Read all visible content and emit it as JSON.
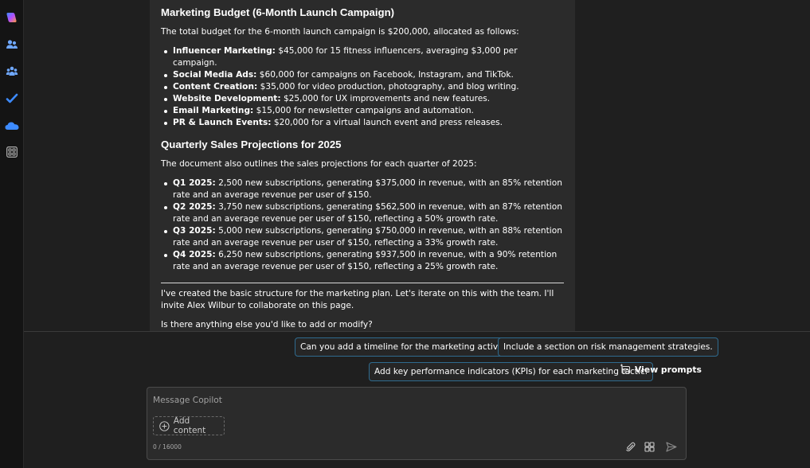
{
  "message": {
    "budget_heading": "Marketing Budget (6-Month Launch Campaign)",
    "budget_intro": "The total budget for the 6-month launch campaign is $200,000, allocated as follows:",
    "budget_items": [
      {
        "label": "Influencer Marketing:",
        "text": " $45,000 for 15 fitness influencers, averaging $3,000 per campaign."
      },
      {
        "label": "Social Media Ads:",
        "text": " $60,000 for campaigns on Facebook, Instagram, and TikTok."
      },
      {
        "label": "Content Creation:",
        "text": " $35,000 for video production, photography, and blog writing."
      },
      {
        "label": "Website Development:",
        "text": " $25,000 for UX improvements and new features."
      },
      {
        "label": "Email Marketing:",
        "text": " $15,000 for newsletter campaigns and automation."
      },
      {
        "label": "PR & Launch Events:",
        "text": " $20,000 for a virtual launch event and press releases."
      }
    ],
    "sales_heading": "Quarterly Sales Projections for 2025",
    "sales_intro": "The document also outlines the sales projections for each quarter of 2025:",
    "sales_items": [
      {
        "label": "Q1 2025:",
        "text": " 2,500 new subscriptions, generating $375,000 in revenue, with an 85% retention rate and an average revenue per user of $150."
      },
      {
        "label": "Q2 2025:",
        "text": " 3,750 new subscriptions, generating $562,500 in revenue, with an 87% retention rate and an average revenue per user of $150, reflecting a 50% growth rate."
      },
      {
        "label": "Q3 2025:",
        "text": " 5,000 new subscriptions, generating $750,000 in revenue, with an 88% retention rate and an average revenue per user of $150, reflecting a 33% growth rate."
      },
      {
        "label": "Q4 2025:",
        "text": " 6,250 new subscriptions, generating $937,500 in revenue, with a 90% retention rate and an average revenue per user of $150, reflecting a 25% growth rate."
      }
    ],
    "closing": "I've created the basic structure for the marketing plan. Let's iterate on this with the team. I'll invite Alex Wilbur to collaborate on this page.",
    "question": "Is there anything else you'd like to add or modify?"
  },
  "suggestions": {
    "timeline": "Can you add a timeline for the marketing activities?",
    "risk": "Include a section on risk management strategies.",
    "kpis": "Add key performance indicators (KPIs) for each marketing tactic.",
    "view_prompts": "View prompts"
  },
  "composer": {
    "placeholder": "Message Copilot",
    "add_content": "Add content",
    "counter": "0 / 16000"
  },
  "rail": {
    "icons": [
      "copilot-icon",
      "people-icon",
      "teams-icon",
      "todo-check-icon",
      "onedrive-cloud-icon",
      "apps-grid-icon"
    ]
  },
  "colors": {
    "accent_border": "#2f6b8f",
    "message_bg": "#2b2b2b",
    "page_bg": "#1f1f1f"
  }
}
